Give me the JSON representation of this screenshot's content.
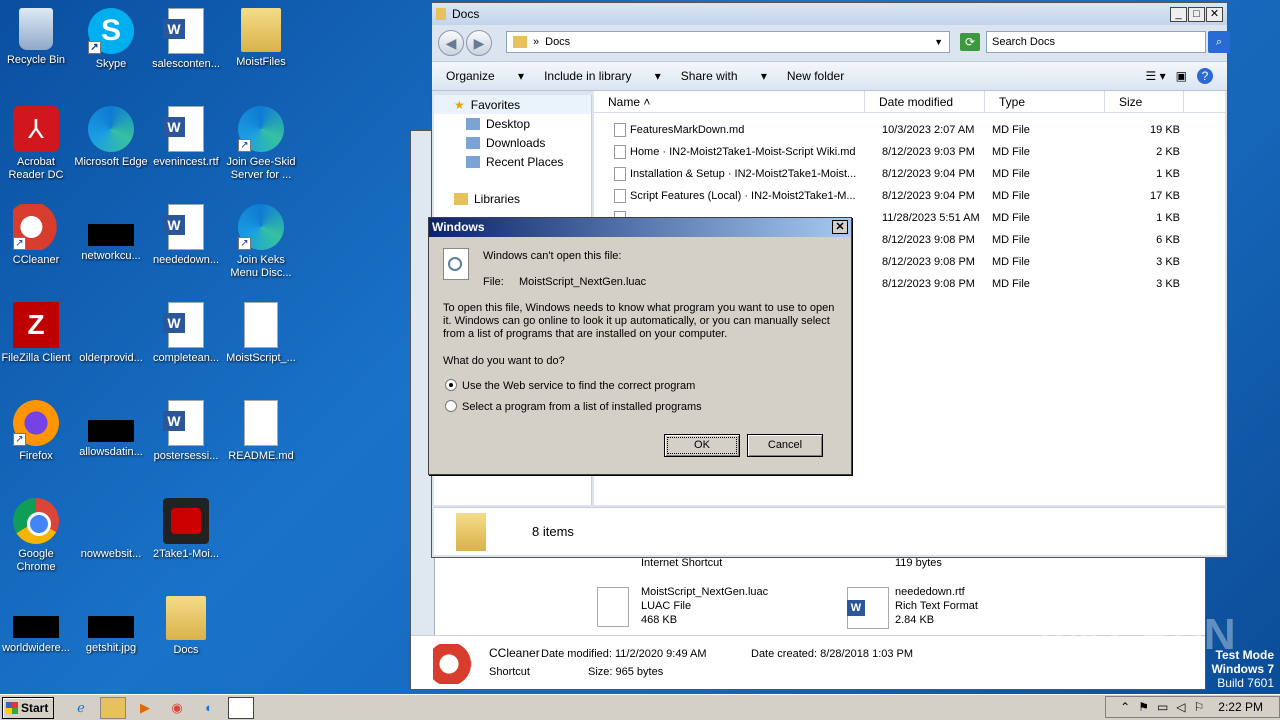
{
  "desktop": {
    "icons": [
      {
        "label": "Recycle Bin"
      },
      {
        "label": "Skype"
      },
      {
        "label": "salesconten..."
      },
      {
        "label": "MoistFiles"
      },
      {
        "label": "Acrobat Reader DC"
      },
      {
        "label": "Microsoft Edge"
      },
      {
        "label": "evenincest.rtf"
      },
      {
        "label": "Join Gee-Skid Server for ..."
      },
      {
        "label": "CCleaner"
      },
      {
        "label": "networkcu..."
      },
      {
        "label": "neededown..."
      },
      {
        "label": "Join Keks Menu Disc..."
      },
      {
        "label": "FileZilla Client"
      },
      {
        "label": "olderprovid..."
      },
      {
        "label": "completean..."
      },
      {
        "label": "MoistScript_..."
      },
      {
        "label": "Firefox"
      },
      {
        "label": "allowsdatin..."
      },
      {
        "label": "postersessi..."
      },
      {
        "label": "README.md"
      },
      {
        "label": "Google Chrome"
      },
      {
        "label": "nowwebsit..."
      },
      {
        "label": "2Take1-Moi..."
      },
      {
        "label": "worldwidere..."
      },
      {
        "label": "getshit.jpg"
      },
      {
        "label": "Docs"
      }
    ]
  },
  "explorer": {
    "title": "Docs",
    "address": "Docs",
    "search_placeholder": "Search Docs",
    "toolbar": {
      "organize": "Organize",
      "include": "Include in library",
      "share": "Share with",
      "newfolder": "New folder"
    },
    "nav": {
      "favorites": "Favorites",
      "desktop": "Desktop",
      "downloads": "Downloads",
      "recent": "Recent Places",
      "libraries": "Libraries"
    },
    "columns": {
      "name": "Name",
      "date": "Date modified",
      "type": "Type",
      "size": "Size"
    },
    "files": [
      {
        "name": "FeaturesMarkDown.md",
        "date": "10/3/2023 2:07 AM",
        "type": "MD File",
        "size": "19 KB"
      },
      {
        "name": "Home · IN2-Moist2Take1-Moist-Script Wiki.md",
        "date": "8/12/2023 9:03 PM",
        "type": "MD File",
        "size": "2 KB"
      },
      {
        "name": "Installation & Setup · IN2-Moist2Take1-Moist...",
        "date": "8/12/2023 9:04 PM",
        "type": "MD File",
        "size": "1 KB"
      },
      {
        "name": "Script Features (Local) · IN2-Moist2Take1-M...",
        "date": "8/12/2023 9:04 PM",
        "type": "MD File",
        "size": "17 KB"
      },
      {
        "name": "",
        "date": "11/28/2023 5:51 AM",
        "type": "MD File",
        "size": "1 KB"
      },
      {
        "name": "",
        "date": "8/12/2023 9:08 PM",
        "type": "MD File",
        "size": "6 KB"
      },
      {
        "name": "",
        "date": "8/12/2023 9:08 PM",
        "type": "MD File",
        "size": "3 KB"
      },
      {
        "name": "",
        "date": "8/12/2023 9:08 PM",
        "type": "MD File",
        "size": "3 KB"
      }
    ],
    "status": "8 items"
  },
  "background_window": {
    "items": [
      {
        "name": "MoistScript_NextGen.luac",
        "type": "LUAC File",
        "size": "468 KB"
      },
      {
        "name": "neededown.rtf",
        "type": "Rich Text Format",
        "size": "2.84 KB"
      }
    ],
    "partial_top_left": "Internet Shortcut",
    "partial_top_right": "119 bytes",
    "details": {
      "name": "CCleaner",
      "kind": "Shortcut",
      "modified": "Date modified: 11/2/2020 9:49 AM",
      "created": "Date created: 8/28/2018 1:03 PM",
      "size": "Size: 965 bytes"
    }
  },
  "dialog": {
    "title": "Windows",
    "message": "Windows can't open this file:",
    "file_label": "File:",
    "file_name": "MoistScript_NextGen.luac",
    "explanation": "To open this file, Windows needs to know what program you want to use to open it. Windows can go online to look it up automatically, or you can manually select from a list of programs that are installed on your computer.",
    "question": "What do you want to do?",
    "option1": "Use the Web service to find the correct program",
    "option2": "Select a program from a list of installed programs",
    "ok": "OK",
    "cancel": "Cancel"
  },
  "taskbar": {
    "start": "Start",
    "clock": "2:22 PM"
  },
  "watermark": {
    "line1": "Test Mode",
    "line2": "Windows 7",
    "line3": "Build 7601",
    "brand": "ANY RUN"
  }
}
